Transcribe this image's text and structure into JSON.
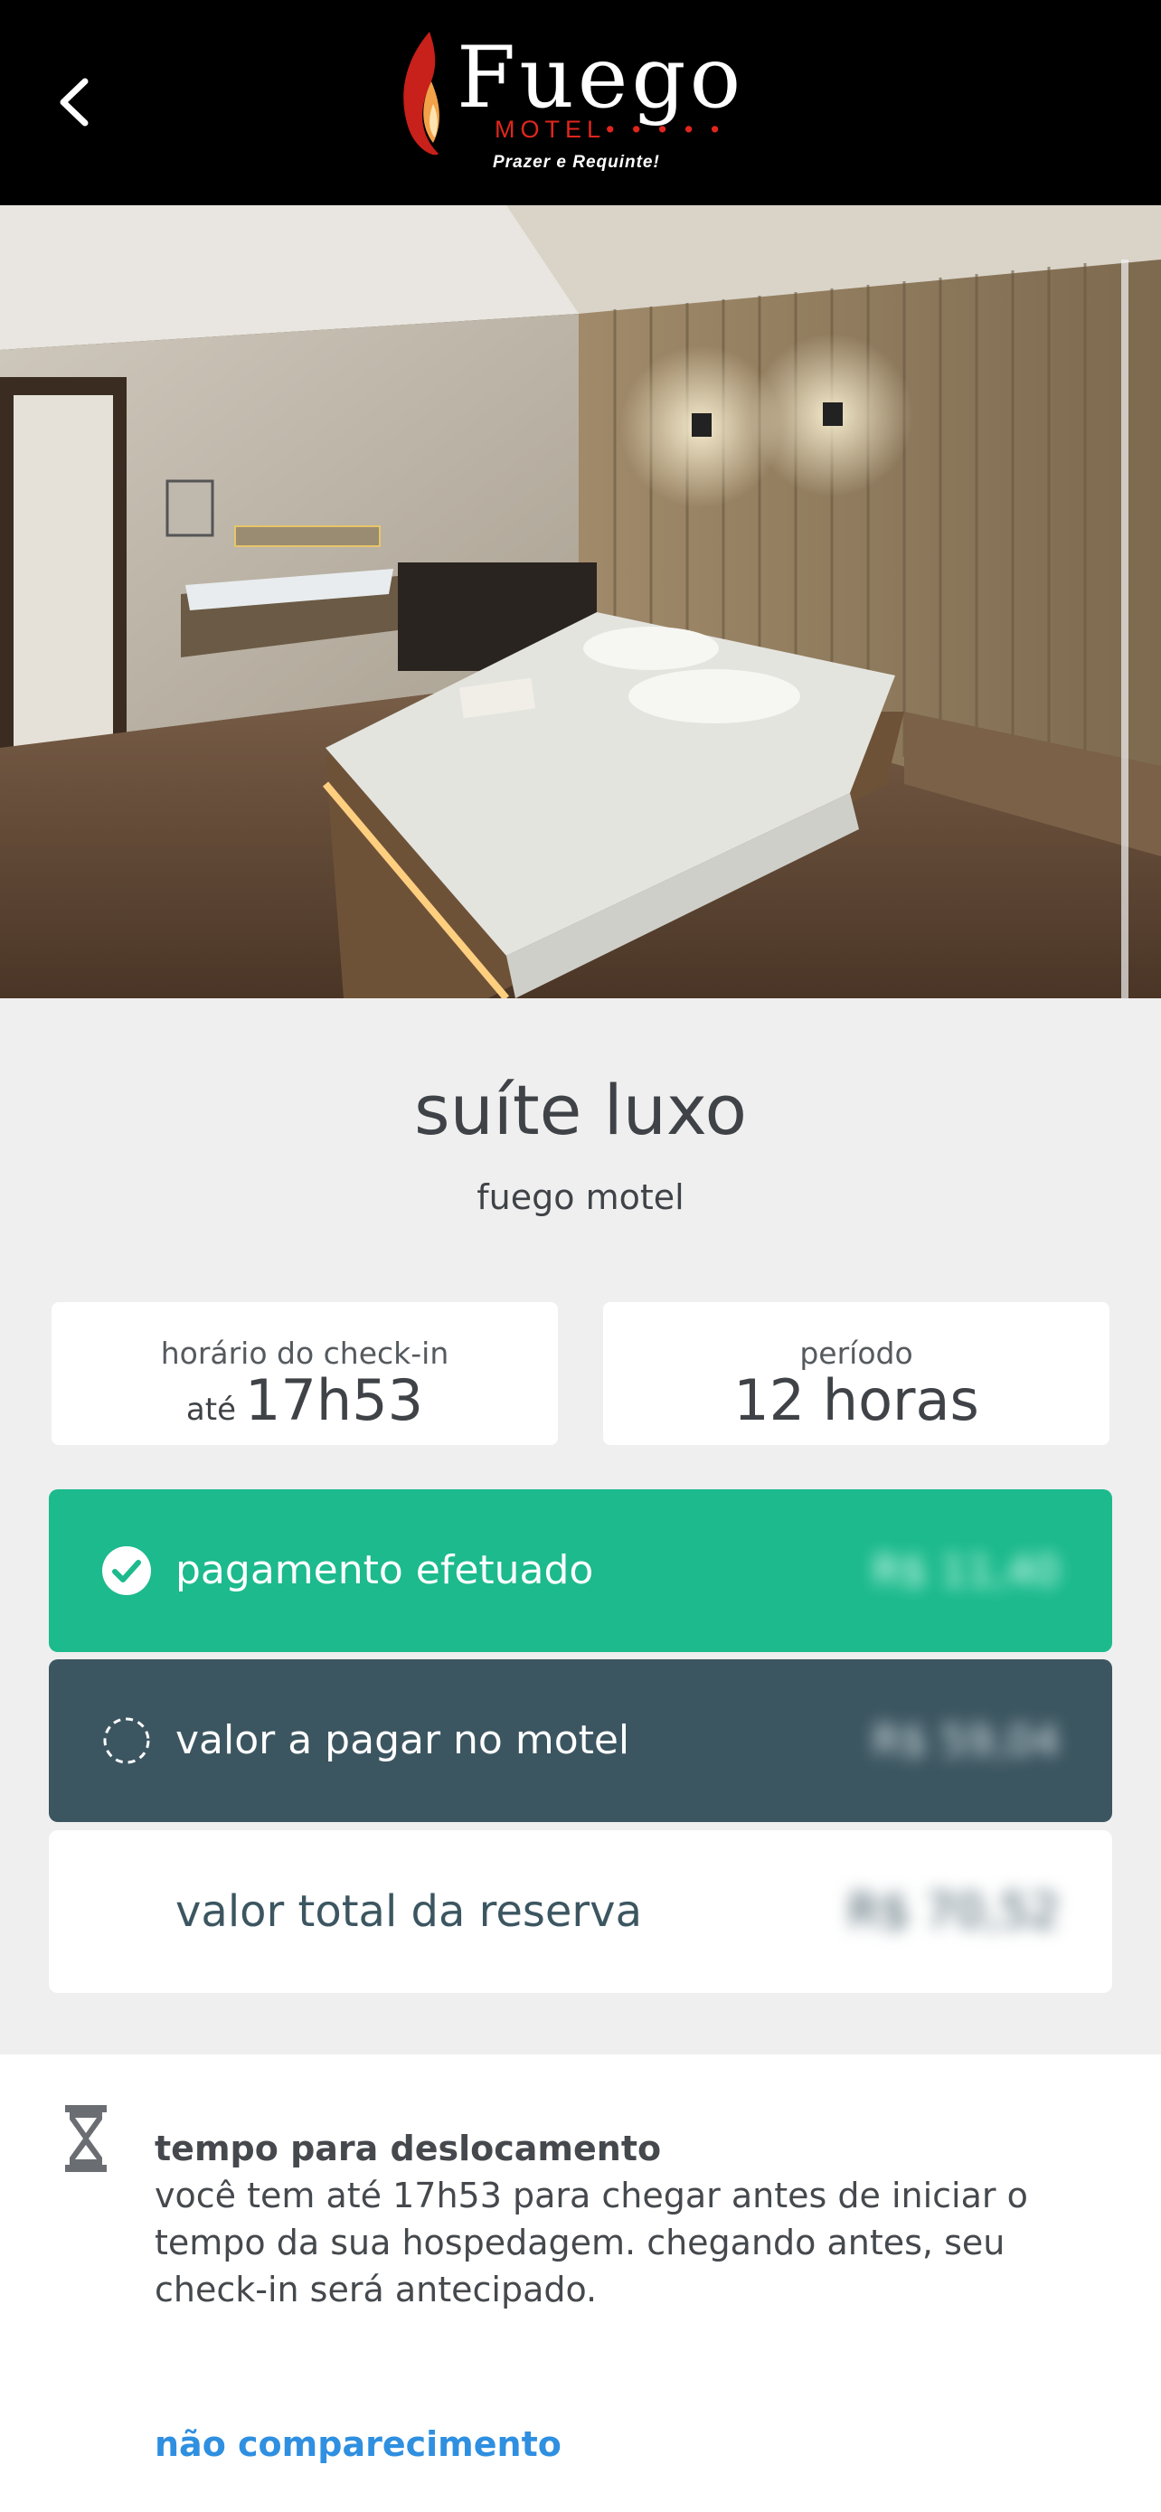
{
  "header": {
    "back_icon": "chevron-left-icon",
    "logo": {
      "name": "Fuego",
      "sub": "MOTEL",
      "dots": "• • • • •",
      "tagline": "Prazer e Requinte!"
    }
  },
  "photo": {
    "icon": "suite-photo"
  },
  "suite": {
    "name": "suíte luxo",
    "motel": "fuego motel"
  },
  "checkin": {
    "label": "horário do check-in",
    "prefix": "até",
    "value": "17h53"
  },
  "period": {
    "label": "período",
    "value": "12 horas"
  },
  "payments": {
    "paid": {
      "label": "pagamento efetuado",
      "value": "R$ 11,40",
      "icon": "check-circle-icon",
      "color": "#1cba8d"
    },
    "pending": {
      "label": "valor a pagar no motel",
      "value": "R$ 59,04",
      "icon": "dashed-circle-icon",
      "color": "#3c5661"
    },
    "total": {
      "label": "valor total da reserva",
      "value": "R$ 70,52"
    }
  },
  "travel": {
    "icon": "hourglass-icon",
    "title": "tempo para deslocamento",
    "text": "você tem até 17h53 para chegar antes de iniciar o tempo da sua hospedagem. chegando antes, seu check-in será antecipado.",
    "link": "não comparecimento"
  }
}
